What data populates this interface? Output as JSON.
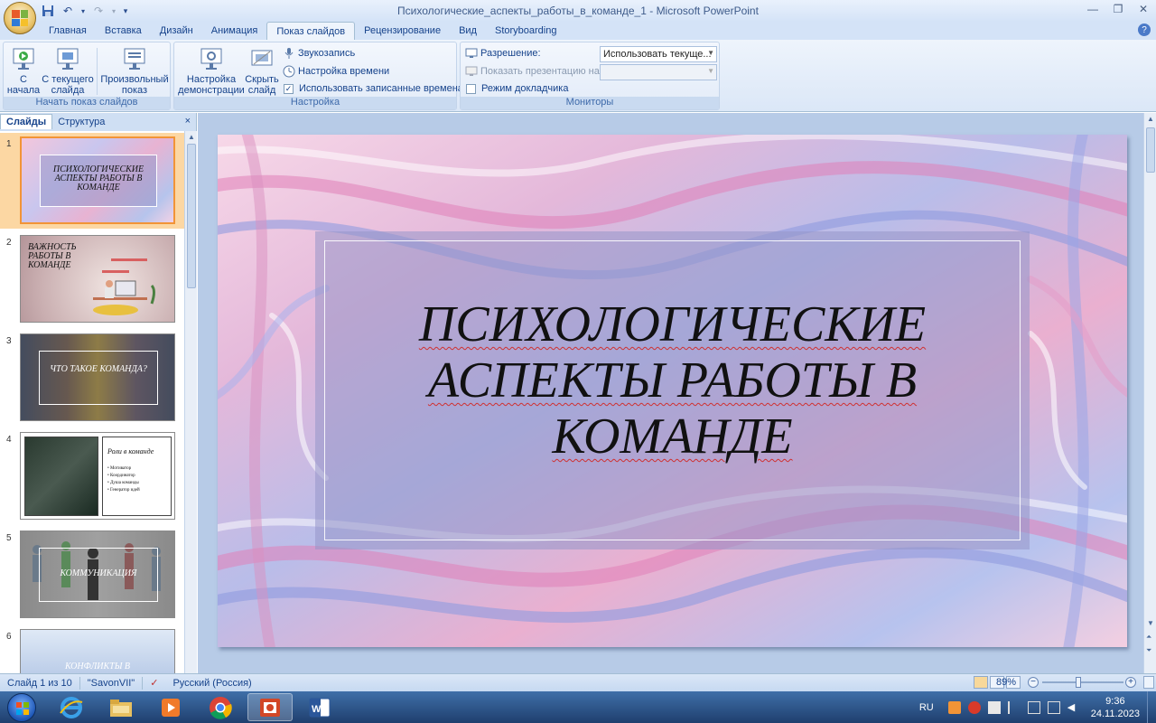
{
  "window": {
    "title": "Психологические_аспекты_работы_в_команде_1 - Microsoft PowerPoint"
  },
  "tabs": [
    "Главная",
    "Вставка",
    "Дизайн",
    "Анимация",
    "Показ слайдов",
    "Рецензирование",
    "Вид",
    "Storyboarding"
  ],
  "active_tab": "Показ слайдов",
  "ribbon": {
    "start_group": {
      "label": "Начать показ слайдов",
      "from_start": "С\nначала",
      "from_current": "С текущего\nслайда",
      "custom_show": "Произвольный\nпоказ"
    },
    "setup_group": {
      "label": "Настройка",
      "setup_show": "Настройка\nдемонстрации",
      "hide_slide": "Скрыть\nслайд",
      "record_narration": "Звукозапись",
      "rehearse_timings": "Настройка времени",
      "use_timings": "Использовать записанные времена",
      "use_timings_checked": "✓"
    },
    "monitors_group": {
      "label": "Мониторы",
      "resolution_label": "Разрешение:",
      "resolution_value": "Использовать текуще...",
      "show_on_label": "Показать презентацию на:",
      "show_on_value": "",
      "presenter_view": "Режим докладчика"
    }
  },
  "left_pane": {
    "tab_slides": "Слайды",
    "tab_outline": "Структура",
    "close": "×",
    "slides": [
      {
        "num": "1",
        "title": "ПСИХОЛОГИЧЕСКИЕ АСПЕКТЫ РАБОТЫ В КОМАНДЕ"
      },
      {
        "num": "2",
        "title": "ВАЖНОСТЬ РАБОТЫ В КОМАНДЕ"
      },
      {
        "num": "3",
        "title": "ЧТО ТАКОЕ КОМАНДА?"
      },
      {
        "num": "4",
        "title": "Роли в команде",
        "bullets": [
          "• Мотиватор",
          "• Координатор",
          "• Душа команды",
          "• Генератор идей"
        ]
      },
      {
        "num": "5",
        "title": "КОММУНИКАЦИЯ"
      },
      {
        "num": "6",
        "title": "КОНФЛИКТЫ В"
      }
    ]
  },
  "slide": {
    "title_lines": [
      "ПСИХОЛОГИЧЕСКИЕ",
      "АСПЕКТЫ РАБОТЫ В",
      "КОМАНДЕ"
    ]
  },
  "status": {
    "slide_counter": "Слайд 1 из 10",
    "theme": "\"SavonVII\"",
    "language": "Русский (Россия)",
    "zoom": "89%",
    "zoom_level": 0.89
  },
  "taskbar": {
    "lang": "RU",
    "time": "9:36",
    "date": "24.11.2023"
  }
}
